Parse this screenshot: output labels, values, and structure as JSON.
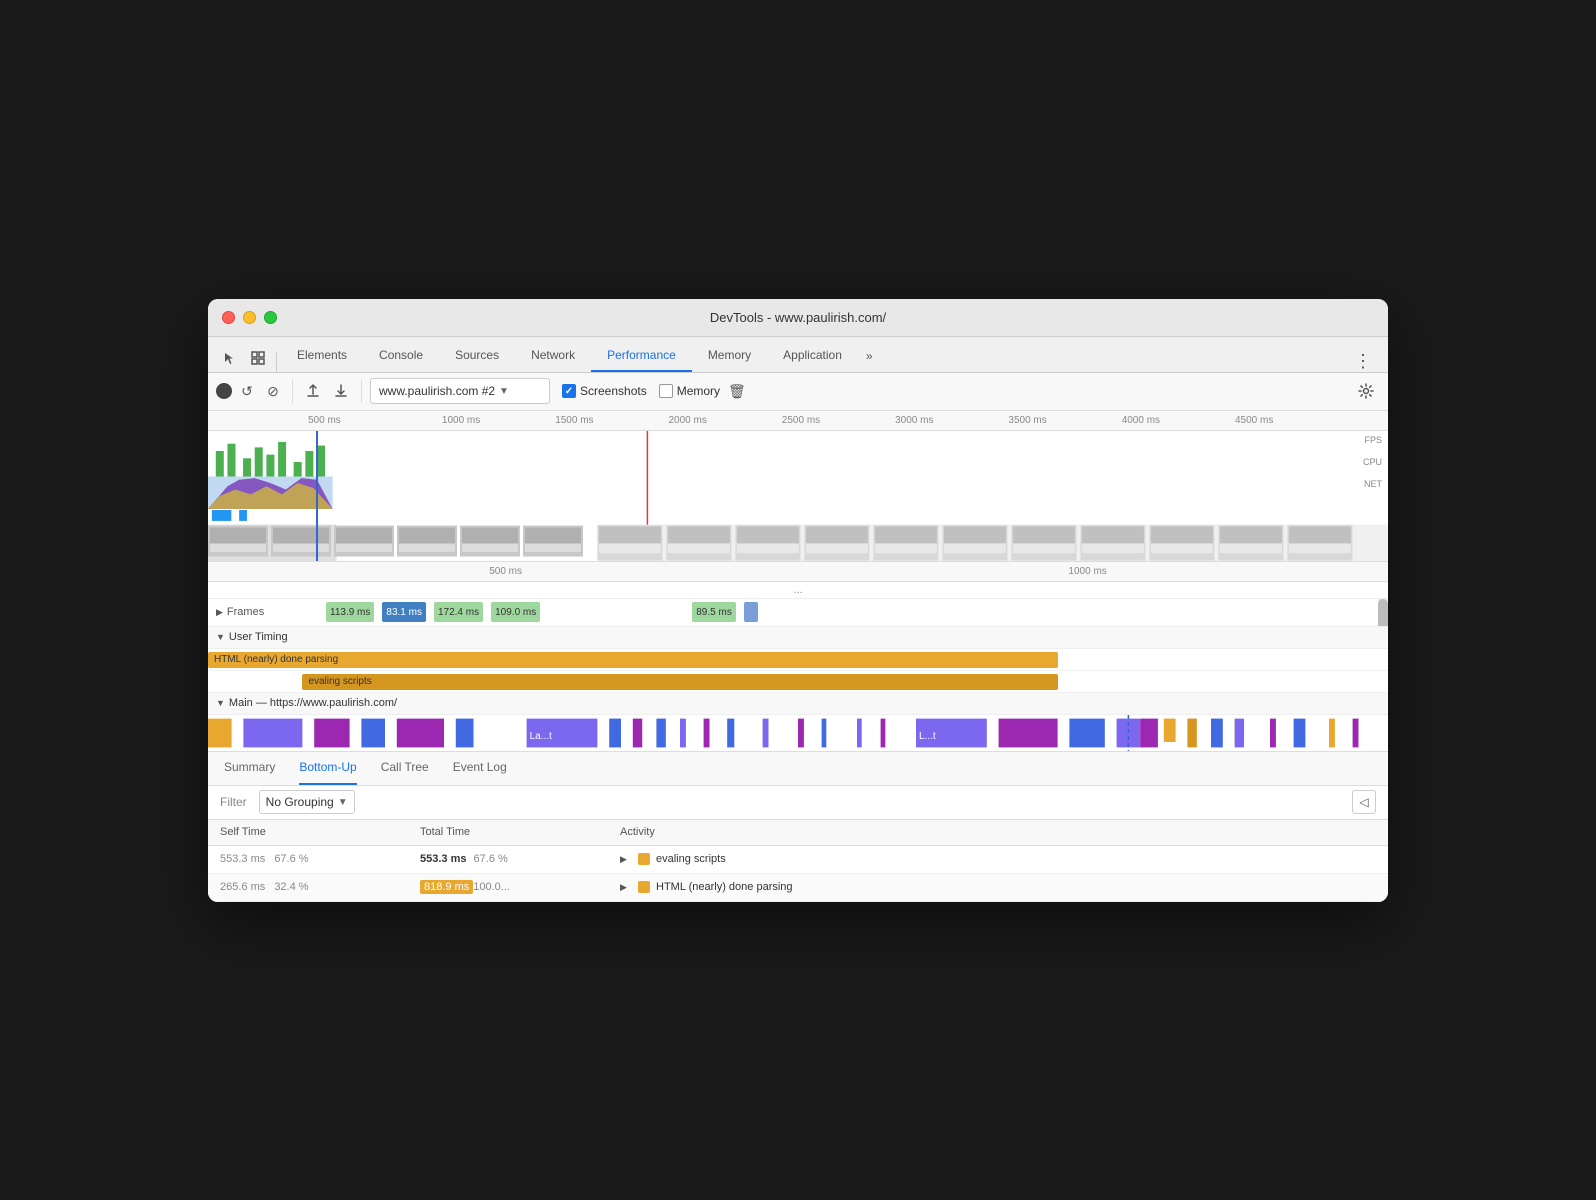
{
  "window": {
    "title": "DevTools - www.paulirish.com/"
  },
  "traffic_lights": {
    "red": "close",
    "yellow": "minimize",
    "green": "maximize"
  },
  "tabs": [
    {
      "label": "Elements",
      "active": false
    },
    {
      "label": "Console",
      "active": false
    },
    {
      "label": "Sources",
      "active": false
    },
    {
      "label": "Network",
      "active": false
    },
    {
      "label": "Performance",
      "active": true
    },
    {
      "label": "Memory",
      "active": false
    },
    {
      "label": "Application",
      "active": false
    }
  ],
  "tab_more": "»",
  "tab_menu": "⋮",
  "toolbar": {
    "record_label": "●",
    "reload_label": "↺",
    "stop_label": "⊘",
    "upload_label": "↑",
    "download_label": "↓",
    "url_value": "www.paulirish.com #2",
    "screenshots_label": "Screenshots",
    "memory_label": "Memory",
    "trash_label": "🗑",
    "settings_label": "⚙"
  },
  "timeline": {
    "ruler_labels": [
      "500 ms",
      "1000 ms",
      "1500 ms",
      "2000 ms",
      "2500 ms",
      "3000 ms",
      "3500 ms",
      "4000 ms",
      "4500 ms"
    ],
    "mini_ruler_labels": [
      "500 ms",
      "1000 ms"
    ],
    "labels_right": [
      "FPS",
      "CPU",
      "NET"
    ]
  },
  "flame_chart": {
    "more_indicator": "...",
    "ruler_label_left": "500 ms",
    "ruler_label_right": "1000 ms"
  },
  "frames": {
    "label": "Frames",
    "values": [
      "113.9 ms",
      "83.1 ms",
      "172.4 ms",
      "109.0 ms",
      "89.5 ms"
    ]
  },
  "user_timing": {
    "label": "User Timing",
    "bars": [
      {
        "label": "HTML (nearly) done parsing",
        "color": "orange"
      },
      {
        "label": "evaling scripts",
        "color": "orange-dark"
      }
    ]
  },
  "main_thread": {
    "label": "Main — https://www.paulirish.com/"
  },
  "analysis_tabs": [
    {
      "label": "Summary",
      "active": false
    },
    {
      "label": "Bottom-Up",
      "active": true
    },
    {
      "label": "Call Tree",
      "active": false
    },
    {
      "label": "Event Log",
      "active": false
    }
  ],
  "filter": {
    "label": "Filter",
    "grouping_value": "No Grouping",
    "grouping_arrow": "▼",
    "toggle_icon": "◁"
  },
  "table": {
    "headers": [
      "Self Time",
      "Total Time",
      "Activity"
    ],
    "rows": [
      {
        "self_time": "553.3 ms",
        "self_pct": "67.6 %",
        "total_time": "553.3 ms",
        "total_pct": "67.6 %",
        "total_highlight": "",
        "activity_color": "#e8a830",
        "activity_name": "evaling scripts",
        "expand": true
      },
      {
        "self_time": "265.6 ms",
        "self_pct": "32.4 %",
        "total_time": "818.9 ms100.0...",
        "total_pct": "",
        "total_highlight": "818.9 ms100.0...",
        "activity_color": "#e8a830",
        "activity_name": "HTML (nearly) done parsing",
        "expand": true
      }
    ]
  }
}
